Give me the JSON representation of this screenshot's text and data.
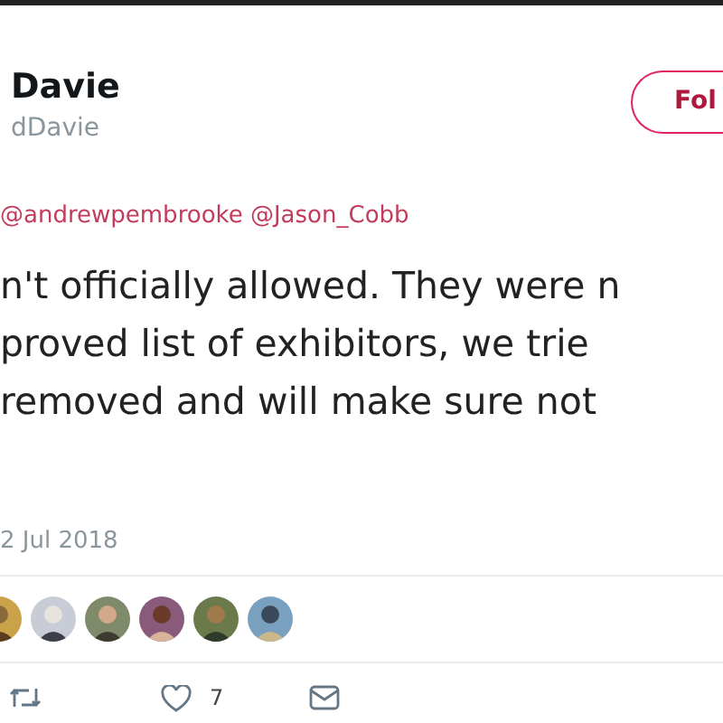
{
  "author": {
    "name": "Davie",
    "handle": "dDavie"
  },
  "follow_button": {
    "label": "Fol"
  },
  "replying_to": "@andrewpembrooke @Jason_Cobb",
  "text_lines": [
    "n't officially allowed. They were n",
    "proved list of exhibitors, we trie",
    "removed and will make sure not"
  ],
  "date": "2 Jul 2018",
  "actions": {
    "like_count": "7"
  }
}
